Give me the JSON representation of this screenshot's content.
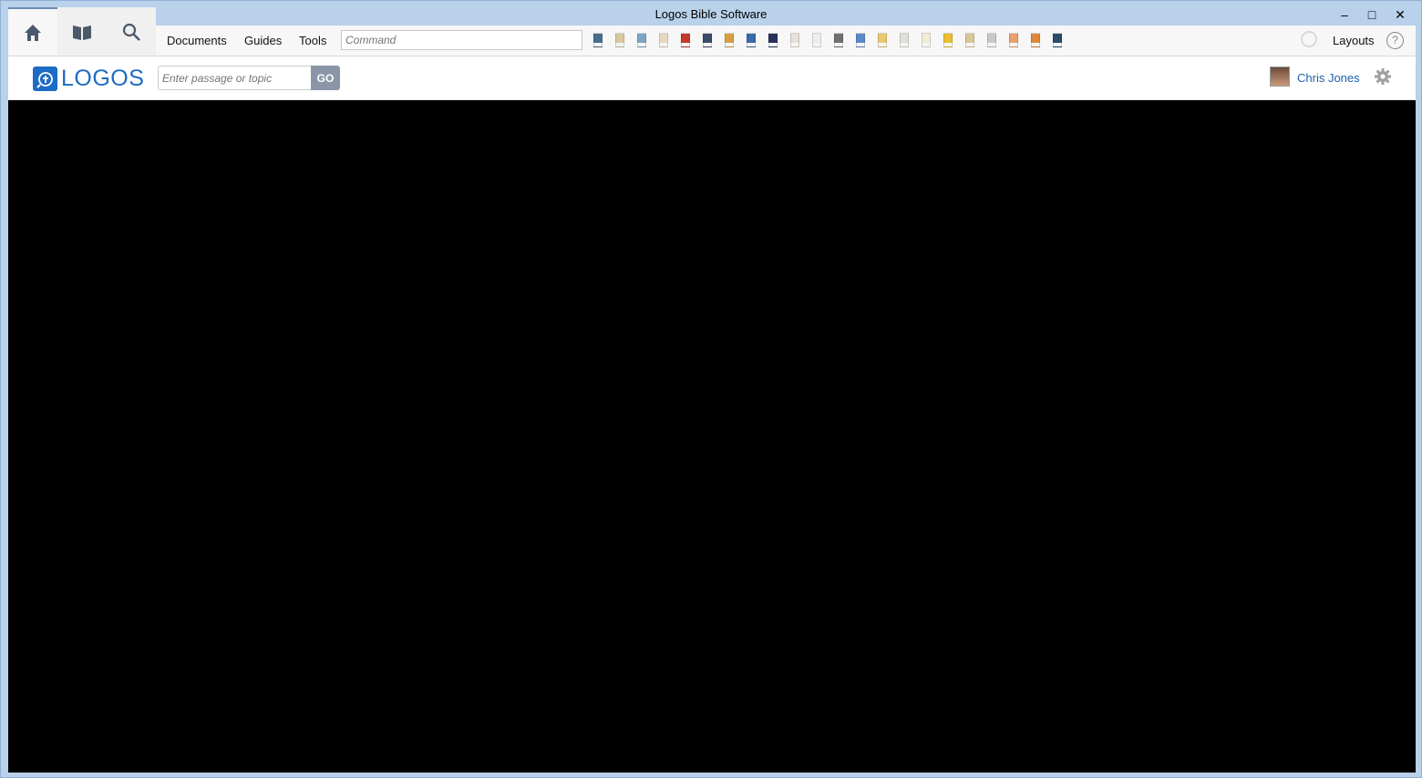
{
  "window": {
    "title": "Logos Bible Software",
    "controls": {
      "minimize": "‒",
      "maximize": "□",
      "close": "✕"
    }
  },
  "tabs": [
    {
      "name": "home",
      "icon": "home-icon",
      "active": true
    },
    {
      "name": "library",
      "icon": "book-icon",
      "active": false
    },
    {
      "name": "search",
      "icon": "search-icon",
      "active": false
    }
  ],
  "menu": {
    "documents": "Documents",
    "guides": "Guides",
    "tools": "Tools"
  },
  "command": {
    "placeholder": "Command"
  },
  "toolbar_books": [
    "#4a6d8f",
    "#d8c8a0",
    "#7aa6c8",
    "#e8d8c0",
    "#c33a2a",
    "#3a4a6a",
    "#d8a040",
    "#3a6aa8",
    "#28305a",
    "#e8e0d8",
    "#f0ece8",
    "#707070",
    "#5a8ac8",
    "#e8c870",
    "#e0e0d8",
    "#f0ecd8",
    "#e8c030",
    "#d8c898",
    "#c8c8c8",
    "#e8a070",
    "#e0883a",
    "#2a4a6a"
  ],
  "layouts": {
    "label": "Layouts",
    "help": "?"
  },
  "header": {
    "logo_text": "LOGOS",
    "passage_placeholder": "Enter passage or topic",
    "go_label": "GO",
    "user_name": "Chris Jones"
  },
  "colors": {
    "accent": "#1d6bc4",
    "content_bg": "#000000",
    "frame": "#b9d1ea"
  }
}
